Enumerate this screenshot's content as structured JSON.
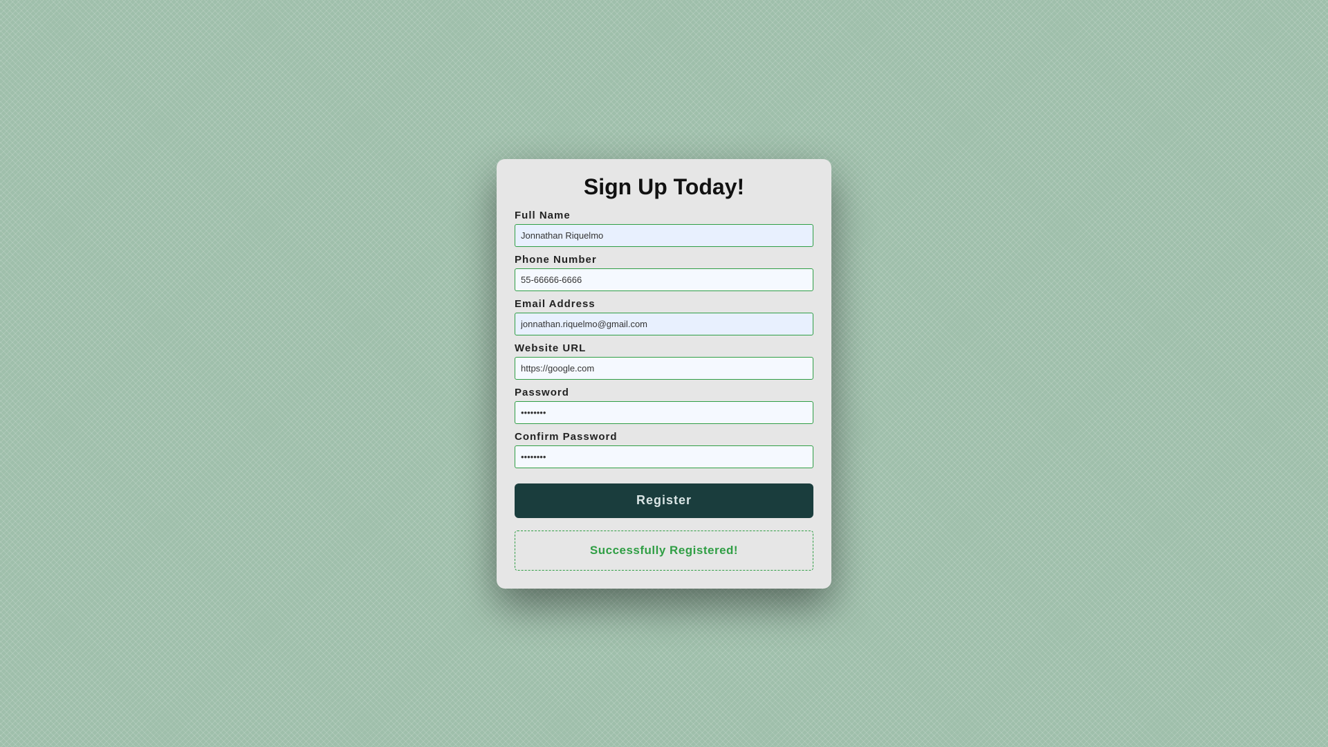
{
  "title": "Sign Up Today!",
  "fields": {
    "fullName": {
      "label": "Full Name",
      "value": "Jonnathan Riquelmo"
    },
    "phone": {
      "label": "Phone Number",
      "value": "55-66666-6666"
    },
    "email": {
      "label": "Email Address",
      "value": "jonnathan.riquelmo@gmail.com"
    },
    "website": {
      "label": "Website URL",
      "value": "https://google.com"
    },
    "password": {
      "label": "Password",
      "value": "••••••••"
    },
    "confirmPassword": {
      "label": "Confirm Password",
      "value": "••••••••"
    }
  },
  "registerButton": "Register",
  "successMessage": "Successfully Registered!"
}
